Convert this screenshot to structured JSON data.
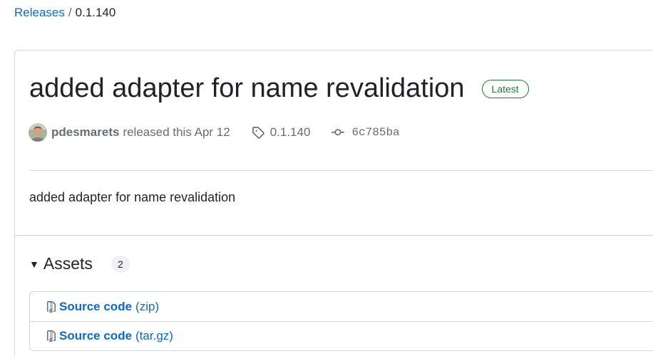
{
  "breadcrumb": {
    "root": "Releases",
    "separator": "/",
    "current": "0.1.140"
  },
  "release": {
    "title": "added adapter for name revalidation",
    "badge": "Latest",
    "author": "pdesmarets",
    "released_text": "released this Apr 12",
    "tag": "0.1.140",
    "commit": "6c785ba",
    "body": "added adapter for name revalidation"
  },
  "assets": {
    "title": "Assets",
    "count": "2",
    "items": [
      {
        "name": "Source code",
        "ext": "(zip)",
        "icon": "file-zip-icon"
      },
      {
        "name": "Source code",
        "ext": "(tar.gz)",
        "icon": "file-zip-icon"
      }
    ]
  },
  "colors": {
    "link": "#0969da",
    "latest": "#1a7f37",
    "muted": "#656d76",
    "border": "#d0d7de"
  }
}
